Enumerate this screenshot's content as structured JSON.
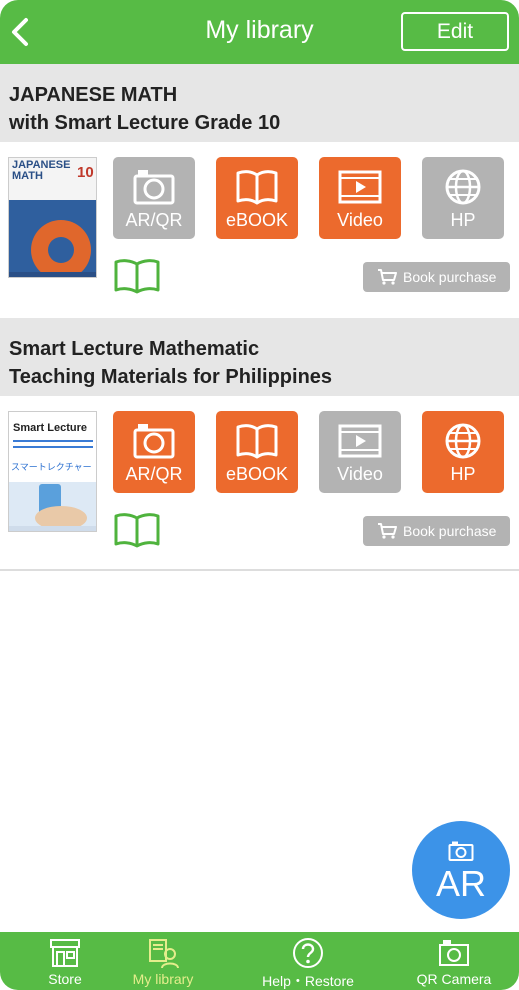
{
  "header": {
    "title": "My library",
    "edit_label": "Edit"
  },
  "books": [
    {
      "title_line1": "JAPANESE MATH",
      "title_line2": "with Smart Lecture Grade 10",
      "cover": {
        "title": "JAPANESE MATH",
        "grade": "10"
      },
      "tiles": [
        {
          "label": "AR/QR",
          "icon": "camera-icon",
          "state": "disabled"
        },
        {
          "label": "eBOOK",
          "icon": "book-icon",
          "state": "enabled"
        },
        {
          "label": "Video",
          "icon": "video-icon",
          "state": "enabled"
        },
        {
          "label": "HP",
          "icon": "globe-icon",
          "state": "disabled"
        }
      ],
      "purchase_label": "Book purchase"
    },
    {
      "title_line1": "Smart Lecture Mathematic",
      "title_line2": "Teaching Materials for Philippines",
      "cover": {
        "title": "Smart Lecture",
        "katakana": "スマートレクチャー"
      },
      "tiles": [
        {
          "label": "AR/QR",
          "icon": "camera-icon",
          "state": "enabled"
        },
        {
          "label": "eBOOK",
          "icon": "book-icon",
          "state": "enabled"
        },
        {
          "label": "Video",
          "icon": "video-icon",
          "state": "disabled"
        },
        {
          "label": "HP",
          "icon": "globe-icon",
          "state": "enabled"
        }
      ],
      "purchase_label": "Book purchase"
    }
  ],
  "ar_button": {
    "label": "AR"
  },
  "bottom_nav": [
    {
      "label": "Store",
      "icon": "store-icon",
      "active": false
    },
    {
      "label": "My library",
      "icon": "library-icon",
      "active": true
    },
    {
      "label": "Help・Restore",
      "icon": "help-icon",
      "active": false
    },
    {
      "label": "QR Camera",
      "icon": "camera-icon",
      "active": false
    }
  ],
  "colors": {
    "brand_green": "#57bb45",
    "accent_orange": "#ec6a2d",
    "disabled_gray": "#b3b3b3",
    "ar_blue": "#3c93e8",
    "nav_active": "#e4ed8c"
  }
}
